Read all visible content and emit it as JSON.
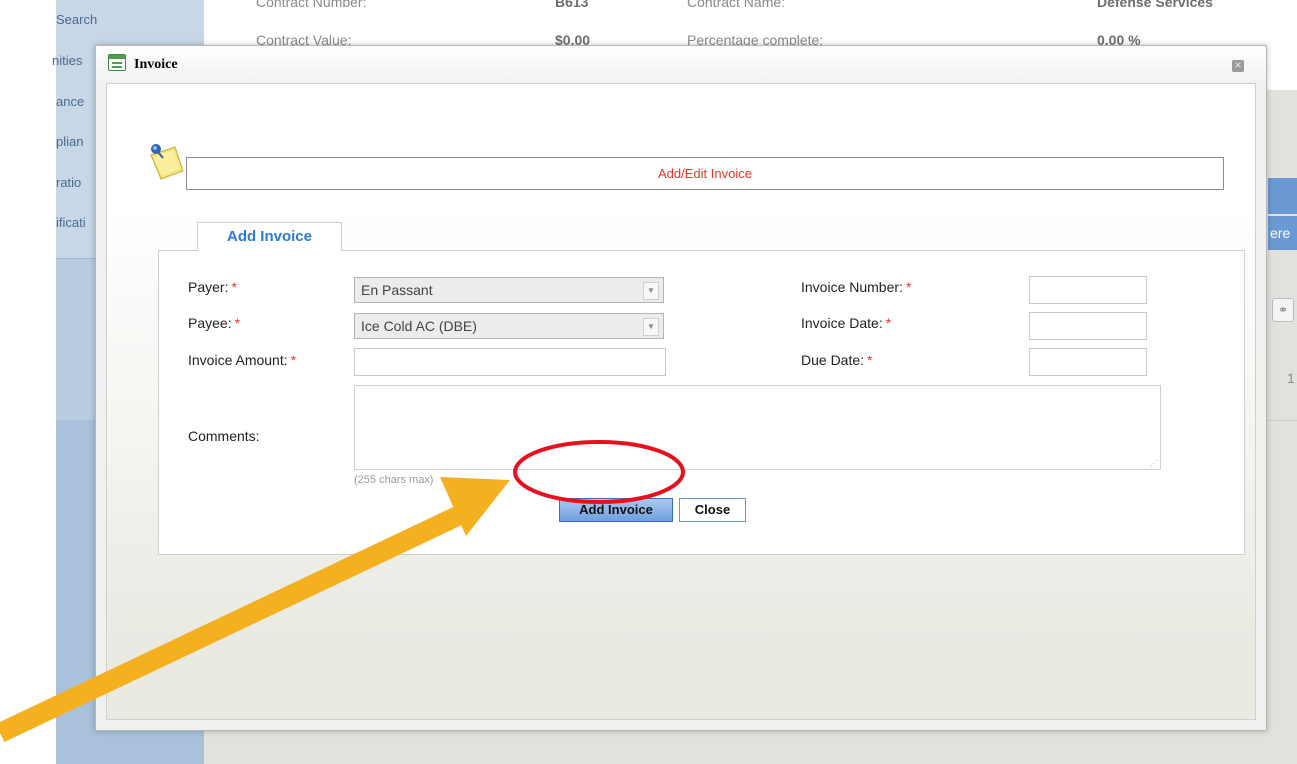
{
  "background": {
    "sidebar_items": [
      "Search",
      "nities",
      "ance",
      "plian",
      "ratio",
      "ificati"
    ],
    "contract_number_label": "Contract Number:",
    "contract_number_value": "B613",
    "contract_name_label": "Contract Name:",
    "contract_name_value": "Defense Services",
    "contract_value_label": "Contract Value:",
    "contract_value_value": "$0.00",
    "percentage_label": "Percentage complete:",
    "percentage_value": "0.00 %",
    "right_tab_fragment": "ere",
    "right_number_fragment": "1"
  },
  "modal": {
    "title": "Invoice",
    "close_glyph": "×",
    "header_title": "Add/Edit Invoice",
    "tab_label": "Add Invoice",
    "form": {
      "payer_label": "Payer:",
      "payer_value": "En Passant",
      "payee_label": "Payee:",
      "payee_value": "Ice Cold AC (DBE)",
      "invoice_amount_label": "Invoice Amount:",
      "invoice_amount_value": "",
      "invoice_number_label": "Invoice Number:",
      "invoice_number_value": "",
      "invoice_date_label": "Invoice Date:",
      "invoice_date_value": "",
      "due_date_label": "Due Date:",
      "due_date_value": "",
      "comments_label": "Comments:",
      "comments_value": "",
      "comments_hint": "(255 chars max)",
      "required_marker": "*"
    },
    "buttons": {
      "add_label": "Add Invoice",
      "close_label": "Close"
    }
  },
  "annotations": {
    "highlight_color": "#e8101e",
    "arrow_color": "#f5b01f"
  },
  "icons": [
    "window-icon",
    "close-icon",
    "sticky-note-icon",
    "dropdown-arrow-icon",
    "paperclip-icon"
  ]
}
